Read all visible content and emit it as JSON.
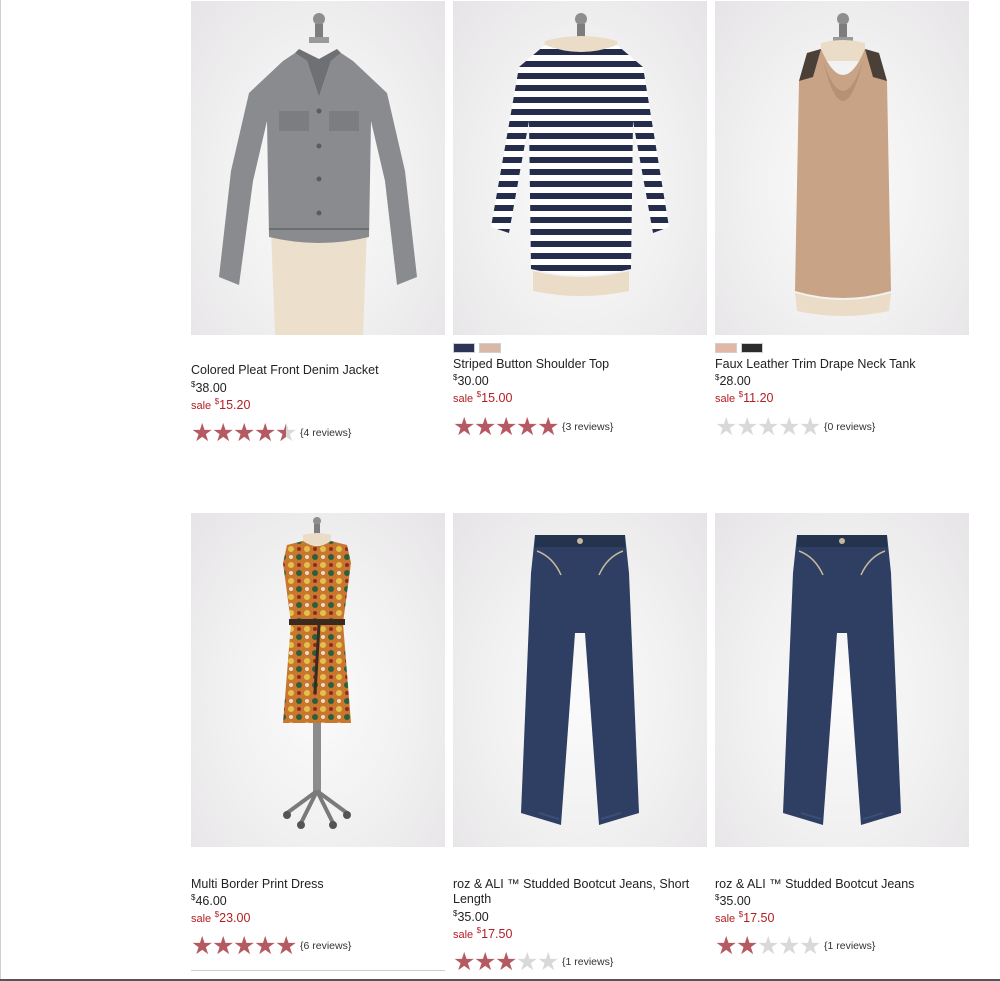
{
  "products": [
    {
      "name": "Colored Pleat Front Denim Jacket",
      "price_symbol": "$",
      "price": "38.00",
      "sale_label": "sale",
      "sale_symbol": "$",
      "sale_price": "15.20",
      "rating": 4.5,
      "reviews": "{4 reviews}",
      "image": "gray-denim-jacket-on-mannequin",
      "swatches": []
    },
    {
      "name": "Striped Button Shoulder Top",
      "price_symbol": "$",
      "price": "30.00",
      "sale_label": "sale",
      "sale_symbol": "$",
      "sale_price": "15.00",
      "rating": 5,
      "reviews": "{3 reviews}",
      "image": "navy-white-striped-top-on-mannequin",
      "swatches": [
        "#2b3356",
        "#d8b9a8"
      ]
    },
    {
      "name": "Faux Leather Trim Drape Neck Tank",
      "price_symbol": "$",
      "price": "28.00",
      "sale_label": "sale",
      "sale_symbol": "$",
      "sale_price": "11.20",
      "rating": 0,
      "reviews": "{0 reviews}",
      "image": "tan-drape-neck-tank-on-mannequin",
      "swatches": [
        "#e2b7a5",
        "#2b2b2b"
      ]
    },
    {
      "name": "Multi Border Print Dress",
      "price_symbol": "$",
      "price": "46.00",
      "sale_label": "sale",
      "sale_symbol": "$",
      "sale_price": "23.00",
      "rating": 5,
      "reviews": "{6 reviews}",
      "image": "print-dress-on-dress-form",
      "swatches": []
    },
    {
      "name": "roz & ALI ™ Studded Bootcut Jeans, Short Length",
      "price_symbol": "$",
      "price": "35.00",
      "sale_label": "sale",
      "sale_symbol": "$",
      "sale_price": "17.50",
      "rating": 3,
      "reviews": "{1 reviews}",
      "image": "dark-wash-bootcut-jeans",
      "swatches": []
    },
    {
      "name": "roz & ALI ™ Studded Bootcut Jeans",
      "price_symbol": "$",
      "price": "35.00",
      "sale_label": "sale",
      "sale_symbol": "$",
      "sale_price": "17.50",
      "rating": 2,
      "reviews": "{1 reviews}",
      "image": "dark-wash-bootcut-jeans",
      "swatches": []
    }
  ],
  "colors": {
    "sale": "#b11f24",
    "star_on": "#b55a62",
    "star_off": "#d9d9d9"
  }
}
